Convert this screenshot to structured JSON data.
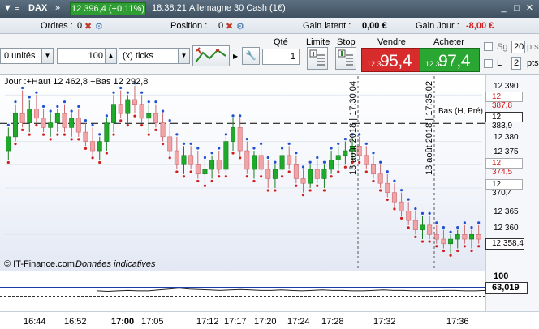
{
  "header": {
    "instrument": "DAX",
    "price_badge": "12 396,4 (+0,11%)",
    "time": "18:38:21",
    "market_name": "Allemagne 30 Cash (1€)",
    "buttons": {
      "minimize": "_",
      "maximize": "□",
      "close": "✕"
    }
  },
  "positions_bar": {
    "orders_label": "Ordres : ",
    "orders_value": "0",
    "position_label": "Position : ",
    "position_value": "0",
    "gain_latent_label": "Gain latent : ",
    "gain_latent_value": "0,00 €",
    "gain_jour_label": "Gain Jour : ",
    "gain_jour_value": "-8,00 €"
  },
  "order_bar": {
    "units_value": "0 unités",
    "qty_value": "100",
    "ticks_value": "(x) ticks",
    "qte_label": "Qté",
    "qte_value": "1",
    "limite_label": "Limite",
    "stop_label": "Stop",
    "sell_label": "Vendre",
    "sell_small": "12 3",
    "sell_big": "95,4",
    "buy_label": "Acheter",
    "buy_small": "12 3",
    "buy_big": "97,4",
    "sg_label": "Sg",
    "sg_value": "20",
    "sg_unit": "pts",
    "l_label": "L",
    "l_value": "2",
    "l_unit": "pts"
  },
  "chart": {
    "info_line": "Jour :+Haut 12 462,8 +Bas 12 292,8",
    "copyright": "© IT-Finance.com",
    "disclaimer": "Données indicatives",
    "hline_label": "Bas (H, Pré)",
    "vline1_label": "13 août 2018 | 17:30:04",
    "vline2_label": "13 août 2018 | 17:35:02",
    "y_ticks": [
      "12 390",
      "12 380",
      "12 375",
      "12 365",
      "12 360"
    ],
    "y_marker_red": "12 387,8",
    "y_marker_hline": "12 383,9",
    "y_marker_red2": "12 374,5",
    "y_marker_gray": "12 370,4",
    "y_marker_last": "12 358,4",
    "ind_top": "100",
    "ind_value": "63,019",
    "x_ticks": [
      "16:44",
      "16:52",
      "17:00",
      "17:05",
      "17:12",
      "17:17",
      "17:20",
      "17:24",
      "17:28",
      "17:32",
      "17:36"
    ]
  },
  "chart_data": {
    "type": "candlestick",
    "y_range": [
      12355,
      12393
    ],
    "up_color": "#1faa2a",
    "down_color": "#f2a3a6",
    "candles": [
      [
        12378,
        12383,
        12376,
        12381
      ],
      [
        12381,
        12388,
        12380,
        12386
      ],
      [
        12386,
        12391,
        12383,
        12384
      ],
      [
        12384,
        12389,
        12382,
        12387
      ],
      [
        12387,
        12390,
        12384,
        12385
      ],
      [
        12385,
        12387,
        12382,
        12383
      ],
      [
        12383,
        12386,
        12381,
        12384
      ],
      [
        12384,
        12387,
        12382,
        12386
      ],
      [
        12386,
        12388,
        12382,
        12383
      ],
      [
        12383,
        12386,
        12381,
        12385
      ],
      [
        12385,
        12387,
        12381,
        12382
      ],
      [
        12382,
        12384,
        12379,
        12380
      ],
      [
        12380,
        12383,
        12377,
        12378
      ],
      [
        12378,
        12381,
        12376,
        12380
      ],
      [
        12380,
        12385,
        12378,
        12384
      ],
      [
        12384,
        12390,
        12382,
        12388
      ],
      [
        12388,
        12391,
        12385,
        12386
      ],
      [
        12386,
        12390,
        12384,
        12389
      ],
      [
        12389,
        12392,
        12386,
        12388
      ],
      [
        12388,
        12390,
        12384,
        12385
      ],
      [
        12385,
        12388,
        12382,
        12386
      ],
      [
        12386,
        12388,
        12383,
        12384
      ],
      [
        12384,
        12386,
        12380,
        12381
      ],
      [
        12381,
        12384,
        12377,
        12378
      ],
      [
        12378,
        12381,
        12374,
        12375
      ],
      [
        12375,
        12379,
        12373,
        12377
      ],
      [
        12377,
        12379,
        12374,
        12375
      ],
      [
        12375,
        12378,
        12372,
        12373
      ],
      [
        12373,
        12376,
        12371,
        12374
      ],
      [
        12374,
        12377,
        12372,
        12376
      ],
      [
        12376,
        12378,
        12373,
        12374
      ],
      [
        12374,
        12381,
        12373,
        12380
      ],
      [
        12380,
        12385,
        12378,
        12383
      ],
      [
        12383,
        12385,
        12377,
        12378
      ],
      [
        12378,
        12380,
        12373,
        12374
      ],
      [
        12374,
        12378,
        12372,
        12377
      ],
      [
        12377,
        12379,
        12373,
        12374
      ],
      [
        12374,
        12376,
        12370,
        12372
      ],
      [
        12372,
        12375,
        12370,
        12374
      ],
      [
        12374,
        12378,
        12373,
        12377
      ],
      [
        12377,
        12379,
        12374,
        12375
      ],
      [
        12375,
        12377,
        12371,
        12372
      ],
      [
        12372,
        12374,
        12369,
        12371
      ],
      [
        12371,
        12375,
        12370,
        12374
      ],
      [
        12374,
        12376,
        12371,
        12372
      ],
      [
        12372,
        12375,
        12370,
        12374
      ],
      [
        12374,
        12378,
        12373,
        12376
      ],
      [
        12376,
        12379,
        12374,
        12377
      ],
      [
        12377,
        12380,
        12375,
        12378
      ],
      [
        12378,
        12381,
        12376,
        12379
      ],
      [
        12379,
        12381,
        12376,
        12377
      ],
      [
        12377,
        12379,
        12374,
        12375
      ],
      [
        12375,
        12377,
        12372,
        12373
      ],
      [
        12373,
        12375,
        12370,
        12371
      ],
      [
        12371,
        12373,
        12368,
        12369
      ],
      [
        12369,
        12371,
        12366,
        12367
      ],
      [
        12367,
        12369,
        12364,
        12365
      ],
      [
        12365,
        12367,
        12362,
        12363
      ],
      [
        12363,
        12365,
        12360,
        12361
      ],
      [
        12361,
        12364,
        12359,
        12362
      ],
      [
        12362,
        12364,
        12359,
        12360
      ],
      [
        12360,
        12362,
        12358,
        12359
      ],
      [
        12359,
        12361,
        12357,
        12358
      ],
      [
        12358,
        12360,
        12356,
        12359
      ],
      [
        12359,
        12361,
        12357,
        12360
      ],
      [
        12360,
        12362,
        12358,
        12359
      ],
      [
        12359,
        12361,
        12357,
        12360
      ],
      [
        12360,
        12362,
        12358,
        12359
      ]
    ],
    "indicator_values": [
      62,
      61,
      62,
      63,
      62,
      62,
      64,
      66,
      68,
      66,
      65,
      64,
      63,
      64,
      65,
      64,
      63,
      63,
      64,
      63,
      62,
      63,
      64,
      63,
      63,
      62,
      62,
      63,
      64,
      63,
      63,
      62,
      62,
      62,
      63,
      63,
      62,
      62,
      63
    ]
  }
}
